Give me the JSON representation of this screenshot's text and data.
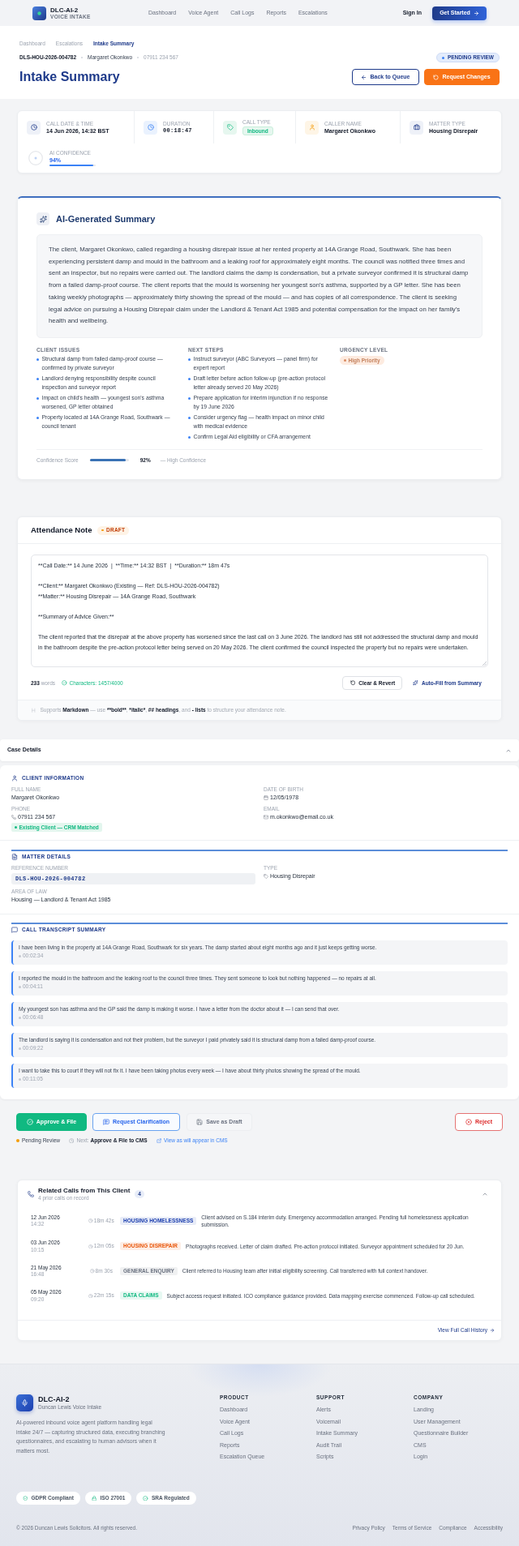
{
  "nav": {
    "brand": "DLC-AI-2",
    "tagline": "VOICE INTAKE",
    "links": [
      "Dashboard",
      "Voice Agent",
      "Call Logs",
      "Reports",
      "Escalations"
    ],
    "sign_in": "Sign In",
    "cta": "Get Started"
  },
  "header": {
    "breadcrumbs": [
      {
        "label": "Dashboard",
        "current": false
      },
      {
        "label": "Escalations",
        "current": false
      },
      {
        "label": "Intake Summary",
        "current": true
      }
    ],
    "reference": "DLS-HOU-2026-004782",
    "client": "Margaret Okonkwo",
    "phone": "07911 234 567",
    "status": "PENDING REVIEW",
    "title": "Intake Summary",
    "buttons": [
      {
        "label": "Back to Queue",
        "kind": "outline"
      },
      {
        "label": "Request Changes",
        "kind": "primary"
      }
    ]
  },
  "stats": [
    {
      "label": "CALL DATE & TIME",
      "value": "14 Jun 2026, 14:32 BST",
      "kind": "text"
    },
    {
      "label": "DURATION",
      "value": "00:18:47",
      "kind": "mono"
    },
    {
      "label": "CALL TYPE",
      "value": "Inbound",
      "kind": "badge"
    },
    {
      "label": "CALLER NAME",
      "value": "Margaret Okonkwo",
      "kind": "text"
    },
    {
      "label": "MATTER TYPE",
      "value": "Housing Disrepair",
      "kind": "text"
    },
    {
      "label": "AI CONFIDENCE",
      "value": "94%",
      "kind": "meter",
      "level": 0.94
    }
  ],
  "ai_summary": {
    "title": "AI-Generated Summary",
    "text": "The client, Margaret Okonkwo, called regarding a housing disrepair issue at her rented property at 14A Grange Road, Southwark. She has been experiencing persistent damp and mould in the bathroom and a leaking roof for approximately eight months. The council was notified three times and sent an inspector, but no repairs were carried out. The landlord claims the damp is condensation, but a private surveyor confirmed it is structural damp from a failed damp-proof course. The client reports that the mould is worsening her youngest son's asthma, supported by a GP letter. She has been taking weekly photographs — approximately thirty showing the spread of the mould — and has copies of all correspondence. The client is seeking legal advice on pursuing a Housing Disrepair claim under the Landlord & Tenant Act 1985 and potential compensation for the impact on her family's health and wellbeing.",
    "lists": [
      {
        "heading": "CLIENT ISSUES",
        "items": [
          "Structural damp from failed damp-proof course — confirmed by private surveyor",
          "Landlord denying responsibility despite council inspection and surveyor report",
          "Impact on child's health — youngest son's asthma worsened, GP letter obtained",
          "Property located at 14A Grange Road, Southwark — council tenant"
        ]
      },
      {
        "heading": "NEXT STEPS",
        "items": [
          "Instruct surveyor (ABC Surveyors — panel firm) for expert report",
          "Draft letter before action follow-up (pre-action protocol letter already served 20 May 2026)",
          "Prepare application for interim injunction if no response by 19 June 2026",
          "Consider urgency flag — health impact on minor child with medical evidence",
          "Confirm Legal Aid eligibility or CFA arrangement"
        ]
      }
    ],
    "urgency": {
      "heading": "URGENCY LEVEL",
      "badge": "High Priority"
    },
    "confidence": {
      "label": "Confidence Score",
      "level": 0.92,
      "value": "92%",
      "note": "— High Confidence"
    }
  },
  "attendance_note": {
    "title": "Attendance Note",
    "status": "DRAFT",
    "value": "**Call Date:** 14 June 2026  |  **Time:** 14:32 BST  |  **Duration:** 18m 47s\n\n**Client:** Margaret Okonkwo (Existing — Ref: DLS-HOU-2026-004782)\n**Matter:** Housing Disrepair — 14A Grange Road, Southwark\n\n**Summary of Advice Given:**\n\nThe client reported that the disrepair at the above property has worsened since the last call on 3 June 2026. The landlord has still not addressed the structural damp and mould in the bathroom despite the pre-action protocol letter being served on 20 May 2026. The client confirmed the council inspected the property but no repairs were undertaken.",
    "word_count": "**233** words",
    "characters": "Characters: 1457/4000",
    "buttons": [
      {
        "label": "Clear & Revert",
        "kind": "outline"
      },
      {
        "label": "Auto-Fill from Summary",
        "kind": "link"
      }
    ],
    "hint": [
      {
        "text": "Supports ",
        "bold": false
      },
      {
        "text": "Markdown",
        "bold": true
      },
      {
        "text": " — use ",
        "bold": false
      },
      {
        "text": "**bold**",
        "bold": true
      },
      {
        "text": ", ",
        "bold": false
      },
      {
        "text": "*italic*",
        "bold": true
      },
      {
        "text": ", ",
        "bold": false
      },
      {
        "text": "## headings",
        "bold": true
      },
      {
        "text": ", and ",
        "bold": false
      },
      {
        "text": "- lists",
        "bold": true
      },
      {
        "text": " to structure your attendance note.",
        "bold": false
      }
    ]
  },
  "case_details": {
    "title": "Case Details",
    "expanded": true,
    "client_information": {
      "heading": "CLIENT INFORMATION",
      "fields": [
        {
          "label": "FULL NAME",
          "value": "Margaret Okonkwo",
          "kind": "text"
        },
        {
          "label": "DATE OF BIRTH",
          "value": "12/05/1978",
          "kind": "date"
        },
        {
          "label": "PHONE",
          "value": "07911 234 567",
          "kind": "phone"
        },
        {
          "label": "EMAIL",
          "value": "m.okonkwo@email.co.uk",
          "kind": "email"
        }
      ],
      "badge": "Existing Client — CRM Matched"
    },
    "matter_details": {
      "heading": "MATTER DETAILS",
      "fields": [
        {
          "label": "REFERENCE NUMBER",
          "value": "DLS-HOU-2026-004782",
          "kind": "code"
        },
        {
          "label": "TYPE",
          "value": "Housing Disrepair",
          "kind": "tag"
        },
        {
          "label": "AREA OF LAW",
          "value": "Housing — Landlord & Tenant Act 1985",
          "kind": "text"
        }
      ]
    },
    "transcript": {
      "heading": "CALL TRANSCRIPT SUMMARY",
      "entries": [
        {
          "text": "I have been living in the property at 14A Grange Road, Southwark for six years. The damp started about eight months ago and it just keeps getting worse.",
          "time": "00:02:34"
        },
        {
          "text": "I reported the mould in the bathroom and the leaking roof to the council three times. They sent someone to look but nothing happened — no repairs at all.",
          "time": "00:04:11"
        },
        {
          "text": "My youngest son has asthma and the GP said the damp is making it worse. I have a letter from the doctor about it — I can send that over.",
          "time": "00:06:48"
        },
        {
          "text": "The landlord is saying it is condensation and not their problem, but the surveyor I paid privately said it is structural damp from a failed damp-proof course.",
          "time": "00:09:22"
        },
        {
          "text": "I want to take this to court if they will not fix it. I have been taking photos every week — I have about thirty photos showing the spread of the mould.",
          "time": "00:11:05"
        }
      ]
    }
  },
  "actions": {
    "buttons": [
      {
        "label": "Approve & File",
        "kind": "primary"
      },
      {
        "label": "Request Clarification",
        "kind": "secondary"
      },
      {
        "label": "Save as Draft",
        "kind": "ghost"
      },
      {
        "label": "Reject",
        "kind": "danger"
      }
    ],
    "status": "Pending Review",
    "next_step": "Next: **Approve & File to CMS**",
    "preview_link": "View as will appear in CMS"
  },
  "related_calls": {
    "title": "Related Calls from This Client",
    "subtitle": "4 prior calls on record",
    "count": "4",
    "expanded": true,
    "calls": [
      {
        "date": "12 Jun 2026",
        "time": "14:32",
        "duration": "18m 42s",
        "tag": "HOUSING HOMELESSNESS",
        "color": "#1e40af",
        "summary": "Client advised on S.184 interim duty. Emergency accommodation arranged. Pending full homelessness application submission."
      },
      {
        "date": "03 Jun 2026",
        "time": "10:15",
        "duration": "12m 05s",
        "tag": "HOUSING DISREPAIR",
        "color": "#ea580c",
        "summary": "Photographs received. Letter of claim drafted. Pre-action protocol initiated. Surveyor appointment scheduled for 20 Jun."
      },
      {
        "date": "21 May 2026",
        "time": "16:48",
        "duration": "8m 30s",
        "tag": "GENERAL ENQUIRY",
        "color": "#6b7280",
        "summary": "Client referred to Housing team after initial eligibility screening. Call transferred with full context handover."
      },
      {
        "date": "05 May 2026",
        "time": "09:20",
        "duration": "22m 15s",
        "tag": "DATA CLAIMS",
        "color": "#10b981",
        "summary": "Subject access request initiated. ICO compliance guidance provided. Data mapping exercise commenced. Follow-up call scheduled."
      }
    ],
    "footer_link": "View Full Call History"
  },
  "footer": {
    "brand": "DLC-AI-2",
    "tagline": "Duncan Lewis Voice Intake",
    "description": "AI-powered inbound voice agent platform handling legal intake 24/7 — capturing structured data, executing branching questionnaires, and escalating to human advisors when it matters most.",
    "columns": [
      {
        "heading": "PRODUCT",
        "links": [
          "Dashboard",
          "Voice Agent",
          "Call Logs",
          "Reports",
          "Escalation Queue"
        ]
      },
      {
        "heading": "SUPPORT",
        "links": [
          "Alerts",
          "Voicemail",
          "Intake Summary",
          "Audit Trail",
          "Scripts"
        ]
      },
      {
        "heading": "COMPANY",
        "links": [
          "Landing",
          "User Management",
          "Questionnaire Builder",
          "CMS",
          "Login"
        ]
      }
    ],
    "badges": [
      "GDPR Compliant",
      "ISO 27001",
      "SRA Regulated"
    ],
    "copyright": "© 2026 Duncan Lewis Solicitors. All rights reserved.",
    "legal_links": [
      "Privacy Policy",
      "Terms of Service",
      "Compliance",
      "Accessibility"
    ]
  }
}
